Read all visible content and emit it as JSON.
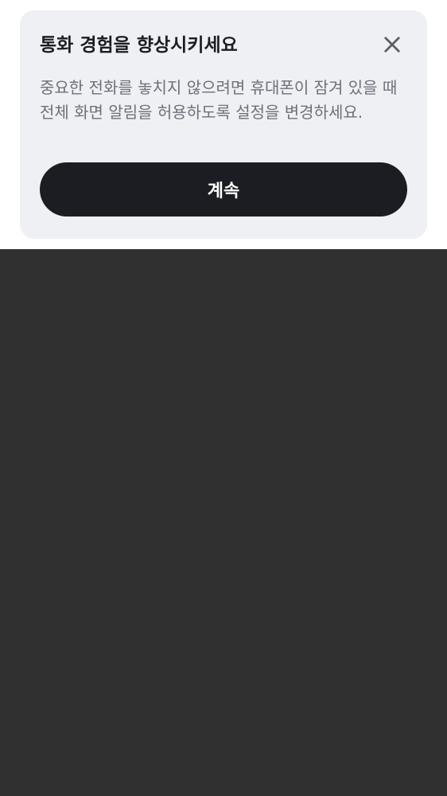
{
  "dialog": {
    "title": "통화 경험을 향상시키세요",
    "description": "중요한 전화를 놓치지 않으려면 휴대폰이 잠겨 있을 때 전체 화면 알림을 허용하도록 설정을 변경하세요.",
    "continue_label": "계속",
    "close_icon": "close-icon"
  },
  "colors": {
    "card_background": "#eff0f4",
    "title_text": "#1c1d22",
    "description_text": "#6d7079",
    "button_background": "#1c1d22",
    "button_text": "#ffffff",
    "scrim": "#303030"
  }
}
